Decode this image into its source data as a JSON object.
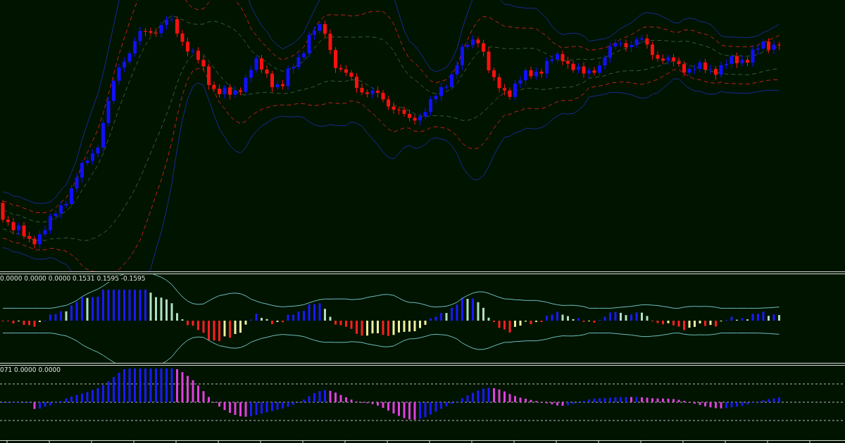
{
  "panes": [
    {
      "kind": "price"
    },
    {
      "kind": "oscillator",
      "readout": "0.0000 0.0000 0.0000 0.1531 0.1595 -0.1595"
    },
    {
      "kind": "histogram",
      "readout": "071 0.0000 0.0000"
    }
  ]
}
